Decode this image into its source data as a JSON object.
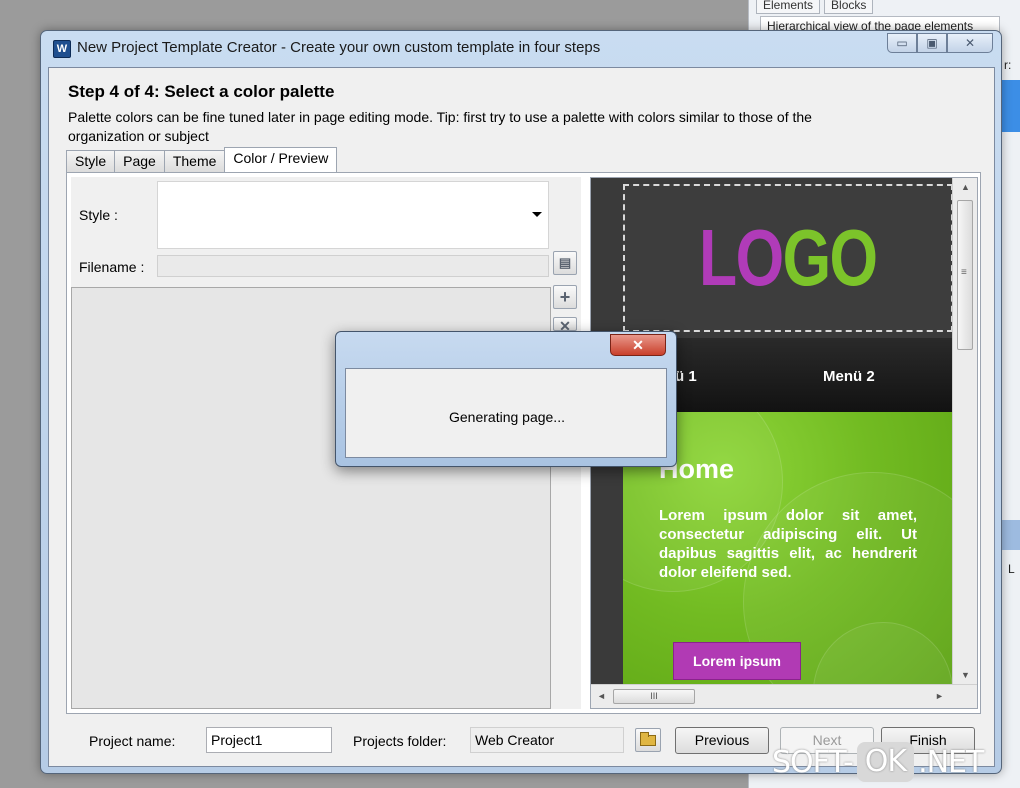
{
  "background_app": {
    "tabs": [
      "Elements",
      "Blocks"
    ],
    "tree_label": "Hierarchical view of the page elements",
    "fragment_r": "r:",
    "fragment_l": "L"
  },
  "window": {
    "title": "New Project Template Creator - Create your own custom template in four steps",
    "icon_text": "W",
    "controls": {
      "minimize": "▭",
      "maximize": "▣",
      "close": "✕"
    }
  },
  "step": {
    "title": "Step 4 of 4: Select a color palette",
    "description": "Palette colors can be fine tuned later in page editing mode. Tip: first try to use a palette with colors similar to those of the organization or subject"
  },
  "tabs": [
    {
      "label": "Style",
      "active": false
    },
    {
      "label": "Page",
      "active": false
    },
    {
      "label": "Theme",
      "active": false
    },
    {
      "label": "Color / Preview",
      "active": true
    }
  ],
  "form": {
    "style_label": "Style :",
    "style_value": "",
    "filename_label": "Filename :",
    "filename_value": ""
  },
  "side_buttons": {
    "browse": "▤",
    "add": "+",
    "remove": "✕"
  },
  "preview": {
    "logo_part1": "LO",
    "logo_part2": "GO",
    "menu": [
      "Menü 1",
      "Menü 2"
    ],
    "heading": "Home",
    "body_text": "Lorem ipsum dolor sit amet, consectetur adipiscing elit. Ut dapibus sagittis elit, ac hendrerit dolor eleifend sed.",
    "button": "Lorem ipsum",
    "scroll_grip": "≡",
    "hscroll_grip": "III",
    "arrows": {
      "up": "▲",
      "down": "▼",
      "left": "◄",
      "right": "►"
    },
    "colors": {
      "accent": "#b13ab4",
      "green": "#72bb22",
      "dark": "#3a3a3a"
    }
  },
  "bottom": {
    "project_name_label": "Project name:",
    "project_name_value": "Project1",
    "projects_folder_label": "Projects folder:",
    "projects_folder_value": "Web Creator",
    "previous": "Previous",
    "next": "Next",
    "finish": "Finish"
  },
  "dialog": {
    "close": "✕",
    "message": "Generating page..."
  },
  "watermark": {
    "left": "SOFT-",
    "middle": "OK",
    "right": ".NET"
  }
}
